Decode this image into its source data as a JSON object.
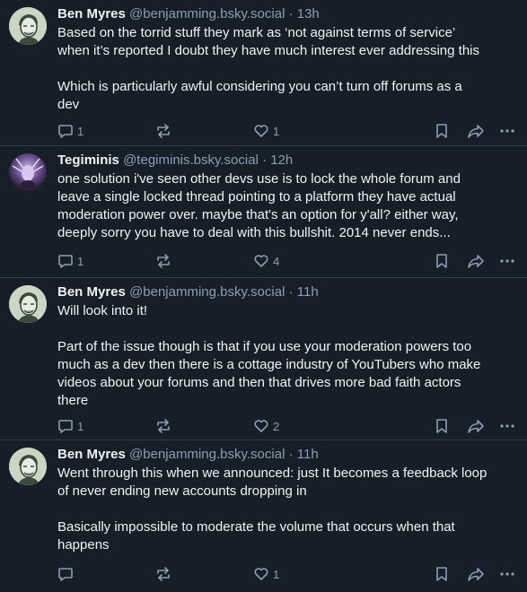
{
  "posts": [
    {
      "author": "Ben Myres",
      "handle": "@benjamming.bsky.social",
      "separator": "·",
      "time": "13h",
      "text": "Based on the torrid stuff they mark as ‘not against terms of service’\nwhen it’s reported I doubt they have much interest ever addressing this\n\nWhich is particularly awful considering you can’t turn off forums as a\ndev",
      "replies": "1",
      "likes": "1"
    },
    {
      "author": "Tegiminis",
      "handle": "@tegiminis.bsky.social",
      "separator": "·",
      "time": "12h",
      "text": "one solution i've seen other devs use is to lock the whole forum and\nleave a single locked thread pointing to a platform they have actual\nmoderation power over. maybe that's an option for y'all? either way,\ndeeply sorry you have to deal with this bullshit. 2014 never ends...",
      "replies": "1",
      "likes": "4"
    },
    {
      "author": "Ben Myres",
      "handle": "@benjamming.bsky.social",
      "separator": "·",
      "time": "11h",
      "text": "Will look into it!\n\nPart of the issue though is that if you use your moderation powers too\nmuch as a dev then there is a cottage industry of YouTubers who make\nvideos about your forums and then that drives more bad faith actors\nthere",
      "replies": "1",
      "likes": "2"
    },
    {
      "author": "Ben Myres",
      "handle": "@benjamming.bsky.social",
      "separator": "·",
      "time": "11h",
      "text": "Went through this when we announced: just It becomes a feedback loop\nof never ending new accounts dropping in\n\nBasically impossible to moderate the volume that occurs when that\nhappens",
      "replies": "",
      "likes": "1"
    }
  ],
  "icons": {
    "reply": "speech-bubble-icon",
    "repost": "repost-arrows-icon",
    "like": "heart-icon",
    "bookmark": "bookmark-icon",
    "share": "share-arrow-icon",
    "more": "ellipsis-icon"
  },
  "colors": {
    "background": "#161e27",
    "text": "#f1f3f5",
    "muted": "#8c9eb2",
    "divider": "#2e3d4d"
  }
}
